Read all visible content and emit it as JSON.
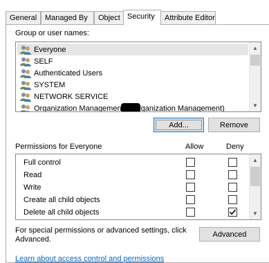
{
  "tabs": [
    {
      "label": "General",
      "active": false
    },
    {
      "label": "Managed By",
      "active": false
    },
    {
      "label": "Object",
      "active": false
    },
    {
      "label": "Security",
      "active": true
    },
    {
      "label": "Attribute Editor",
      "active": false
    }
  ],
  "group_label": "Group or user names:",
  "users": [
    {
      "name": "Everyone",
      "selected": true
    },
    {
      "name": "SELF",
      "selected": false
    },
    {
      "name": "Authenticated Users",
      "selected": false
    },
    {
      "name": "SYSTEM",
      "selected": false
    },
    {
      "name": "NETWORK SERVICE",
      "selected": false
    },
    {
      "name": "Organization Management (      \\Organization Management)",
      "selected": false
    }
  ],
  "add_button": "Add...",
  "remove_button": "Remove",
  "permissions_label": "Permissions for Everyone",
  "allow_label": "Allow",
  "deny_label": "Deny",
  "permissions": [
    {
      "name": "Full control",
      "allow": false,
      "deny": false
    },
    {
      "name": "Read",
      "allow": false,
      "deny": false
    },
    {
      "name": "Write",
      "allow": false,
      "deny": false
    },
    {
      "name": "Create all child objects",
      "allow": false,
      "deny": false
    },
    {
      "name": "Delete all child objects",
      "allow": false,
      "deny": true
    }
  ],
  "special_text": "For special permissions or advanced settings, click Advanced.",
  "advanced_button": "Advanced",
  "learn_link": "Learn about access control and permissions",
  "icon_user": "users-icon",
  "colors": {
    "selected_row": "#e5e5e5",
    "link": "#0066cc",
    "button_bg": "#e1e1e1",
    "focus": "#0078d7"
  }
}
